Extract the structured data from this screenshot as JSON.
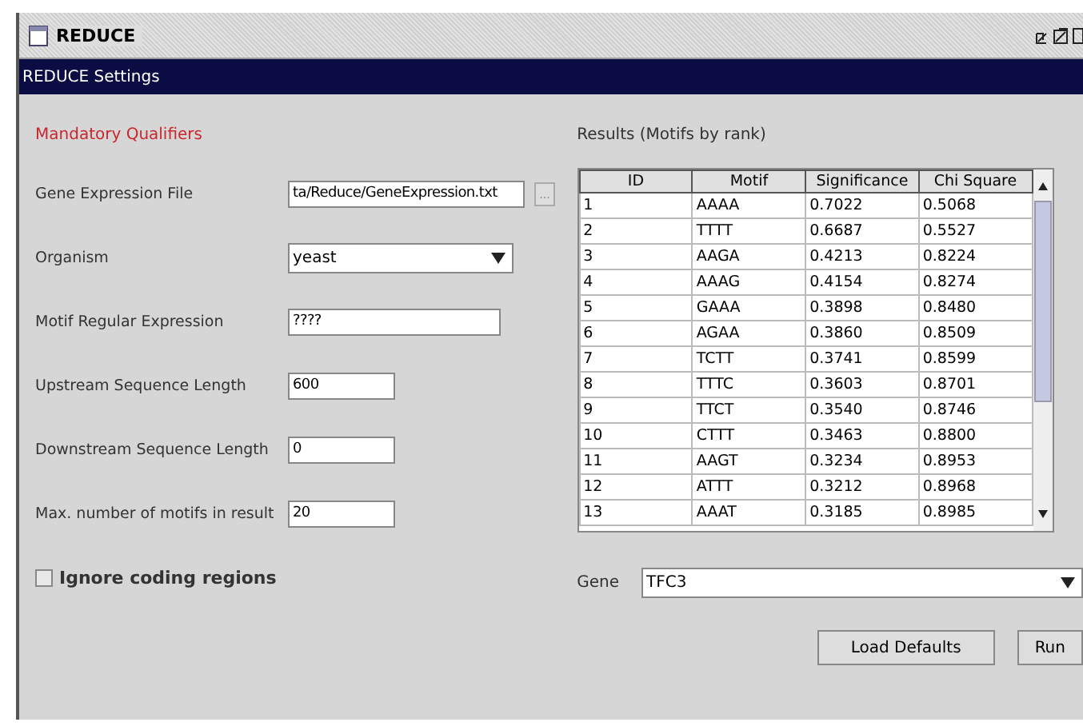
{
  "window": {
    "title": "REDUCE"
  },
  "header": "REDUCE Settings",
  "section_title": "Mandatory Qualifiers",
  "fields": [
    {
      "kind": "file",
      "label": "Gene Expression File",
      "value": "ta/Reduce/GeneExpression.txt",
      "button": "..."
    },
    {
      "kind": "select",
      "label": "Organism",
      "value": "yeast"
    },
    {
      "kind": "text",
      "label": "Motif Regular Expression",
      "value": "????"
    },
    {
      "kind": "short",
      "label": "Upstream Sequence Length",
      "value": "600"
    },
    {
      "kind": "short",
      "label": "Downstream Sequence Length",
      "value": "0"
    },
    {
      "kind": "short",
      "label": "Max. number of motifs in result",
      "value": "20"
    }
  ],
  "ignore_coding": {
    "label": "Ignore coding regions",
    "checked": false
  },
  "results": {
    "title": "Results (Motifs by rank)",
    "columns": [
      "ID",
      "Motif",
      "Significance",
      "Chi Square"
    ],
    "rows": [
      [
        "1",
        "AAAA",
        "0.7022",
        "0.5068"
      ],
      [
        "2",
        "TTTT",
        "0.6687",
        "0.5527"
      ],
      [
        "3",
        "AAGA",
        "0.4213",
        "0.8224"
      ],
      [
        "4",
        "AAAG",
        "0.4154",
        "0.8274"
      ],
      [
        "5",
        "GAAA",
        "0.3898",
        "0.8480"
      ],
      [
        "6",
        "AGAA",
        "0.3860",
        "0.8509"
      ],
      [
        "7",
        "TCTT",
        "0.3741",
        "0.8599"
      ],
      [
        "8",
        "TTTC",
        "0.3603",
        "0.8701"
      ],
      [
        "9",
        "TTCT",
        "0.3540",
        "0.8746"
      ],
      [
        "10",
        "CTTT",
        "0.3463",
        "0.8800"
      ],
      [
        "11",
        "AAGT",
        "0.3234",
        "0.8953"
      ],
      [
        "12",
        "ATTT",
        "0.3212",
        "0.8968"
      ],
      [
        "13",
        "AAAT",
        "0.3185",
        "0.8985"
      ]
    ]
  },
  "gene": {
    "label": "Gene",
    "value": "TFC3"
  },
  "buttons": [
    "Load Defaults",
    "Run"
  ]
}
